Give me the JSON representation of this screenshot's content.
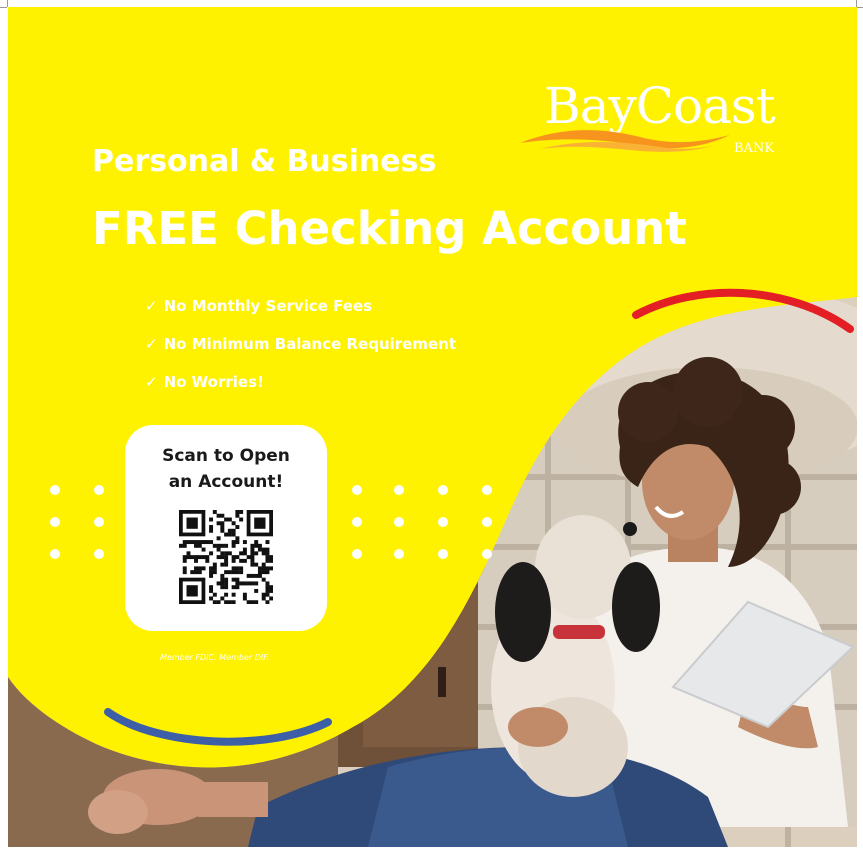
{
  "brand": {
    "name": "BayCoast",
    "sub": "BANK",
    "colors": {
      "swoosh": "#f7941d",
      "background": "#fff200"
    }
  },
  "headline": {
    "kicker": "Personal & Business",
    "title": "FREE Checking Account"
  },
  "features": [
    "No Monthly Service Fees",
    "No Minimum Balance Requirement",
    "No Worries!"
  ],
  "scan": {
    "line1": "Scan to Open",
    "line2": "an Account!"
  },
  "disclaimer": "Member FDIC. Member DIF.",
  "accents": {
    "red_arc": "#e31e24",
    "blue_arc": "#3d5fa8"
  }
}
